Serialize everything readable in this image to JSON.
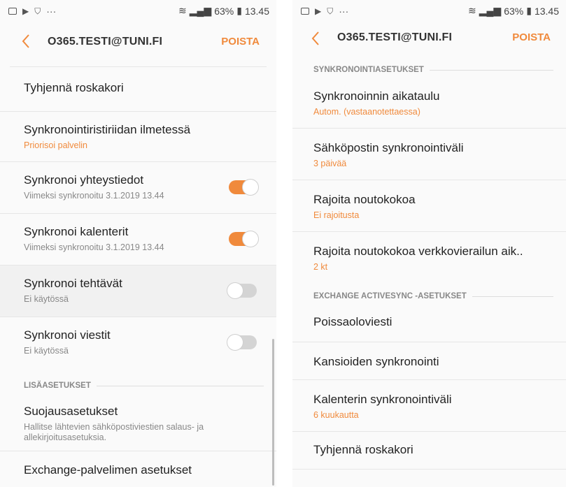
{
  "left": {
    "status": {
      "battery": "63%",
      "time": "13.45",
      "more": "···"
    },
    "header": {
      "title": "O365.TESTI@TUNI.FI",
      "action": "POISTA"
    },
    "items": [
      {
        "title": "Tyhjennä roskakori"
      },
      {
        "title": "Synkronointiristiriidan ilmetessä",
        "subtitle": "Priorisoi palvelin"
      },
      {
        "title": "Synkronoi yhteystiedot",
        "subtitle": "Viimeksi synkronoitu 3.1.2019  13.44",
        "toggle": "on"
      },
      {
        "title": "Synkronoi kalenterit",
        "subtitle": "Viimeksi synkronoitu 3.1.2019  13.44",
        "toggle": "on"
      },
      {
        "title": "Synkronoi tehtävät",
        "subtitle": "Ei käytössä",
        "toggle": "off"
      },
      {
        "title": "Synkronoi viestit",
        "subtitle": "Ei käytössä",
        "toggle": "off"
      }
    ],
    "section": "LISÄASETUKSET",
    "items2": [
      {
        "title": "Suojausasetukset",
        "subtitle": "Hallitse lähtevien sähköpostiviestien salaus- ja allekirjoitusasetuksia."
      },
      {
        "title": "Exchange-palvelimen asetukset"
      }
    ]
  },
  "right": {
    "status": {
      "battery": "63%",
      "time": "13.45",
      "more": "···"
    },
    "header": {
      "title": "O365.TESTI@TUNI.FI",
      "action": "POISTA"
    },
    "section1": "SYNKRONOINTIASETUKSET",
    "items": [
      {
        "title": "Synkronoinnin aikataulu",
        "subtitle": "Autom. (vastaanotettaessa)"
      },
      {
        "title": "Sähköpostin synkronointiväli",
        "subtitle": "3 päivää"
      },
      {
        "title": "Rajoita noutokokoa",
        "subtitle": "Ei rajoitusta"
      },
      {
        "title": "Rajoita noutokokoa verkkovierailun aik..",
        "subtitle": "2 kt"
      }
    ],
    "section2": "EXCHANGE ACTIVESYNC -ASETUKSET",
    "items2": [
      {
        "title": "Poissaoloviesti"
      },
      {
        "title": "Kansioiden synkronointi"
      },
      {
        "title": "Kalenterin synkronointiväli",
        "subtitle": "6 kuukautta"
      },
      {
        "title": "Tyhjennä roskakori"
      }
    ]
  },
  "colors": {
    "accent": "#f08a3c",
    "text": "#222222",
    "subtext": "#888888",
    "divider": "#e6e6e6"
  },
  "icons": [
    "gallery-icon",
    "play-store-icon",
    "shield-icon",
    "wifi-icon",
    "signal-icon",
    "battery-icon",
    "back-arrow-icon"
  ]
}
